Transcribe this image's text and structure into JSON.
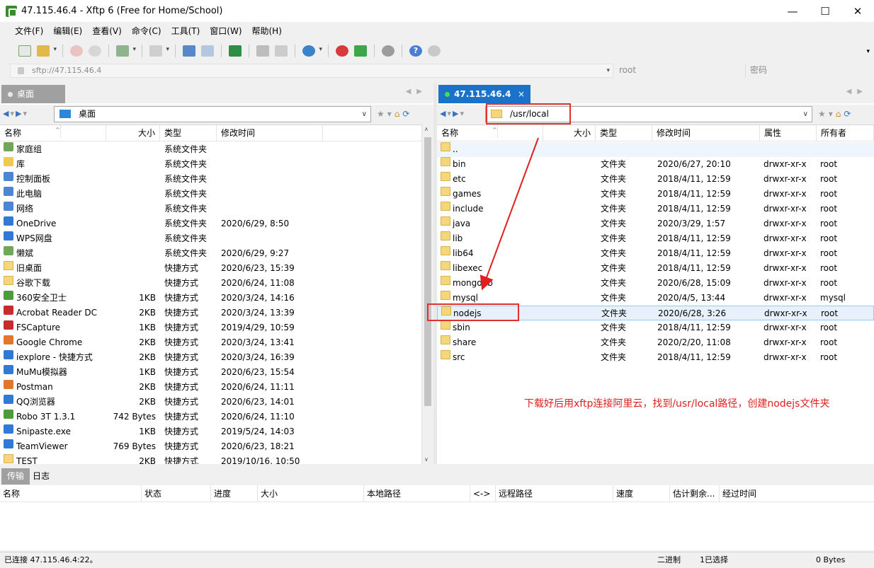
{
  "window": {
    "title": "47.115.46.4 - Xftp 6 (Free for Home/School)",
    "minimize": "—",
    "maximize": "☐",
    "close": "✕"
  },
  "menu": [
    "文件(F)",
    "编辑(E)",
    "查看(V)",
    "命令(C)",
    "工具(T)",
    "窗口(W)",
    "帮助(H)"
  ],
  "addressbar": {
    "url_placeholder": "sftp://47.115.46.4",
    "user_placeholder": "root",
    "password_placeholder": "密码"
  },
  "left": {
    "tab": "桌面",
    "path": "桌面",
    "columns": [
      "名称",
      "大小",
      "类型",
      "修改时间"
    ],
    "rows": [
      {
        "name": "家庭组",
        "size": "",
        "type": "系统文件夹",
        "date": "",
        "icon": "sys2"
      },
      {
        "name": "库",
        "size": "",
        "type": "系统文件夹",
        "date": "",
        "icon": "shortcut"
      },
      {
        "name": "控制面板",
        "size": "",
        "type": "系统文件夹",
        "date": "",
        "icon": "sys"
      },
      {
        "name": "此电脑",
        "size": "",
        "type": "系统文件夹",
        "date": "",
        "icon": "sys"
      },
      {
        "name": "网络",
        "size": "",
        "type": "系统文件夹",
        "date": "",
        "icon": "sys"
      },
      {
        "name": "OneDrive",
        "size": "",
        "type": "系统文件夹",
        "date": "2020/6/29, 8:50",
        "icon": "app-blue"
      },
      {
        "name": "WPS网盘",
        "size": "",
        "type": "系统文件夹",
        "date": "",
        "icon": "app-blue"
      },
      {
        "name": "懒斌",
        "size": "",
        "type": "系统文件夹",
        "date": "2020/6/29, 9:27",
        "icon": "sys2"
      },
      {
        "name": "旧桌面",
        "size": "",
        "type": "快捷方式",
        "date": "2020/6/23, 15:39",
        "icon": "folder"
      },
      {
        "name": "谷歌下载",
        "size": "",
        "type": "快捷方式",
        "date": "2020/6/24, 11:08",
        "icon": "folder"
      },
      {
        "name": "360安全卫士",
        "size": "1KB",
        "type": "快捷方式",
        "date": "2020/3/24, 14:16",
        "icon": "app-green"
      },
      {
        "name": "Acrobat Reader DC",
        "size": "2KB",
        "type": "快捷方式",
        "date": "2020/3/24, 13:39",
        "icon": "app-red"
      },
      {
        "name": "FSCapture",
        "size": "1KB",
        "type": "快捷方式",
        "date": "2019/4/29, 10:59",
        "icon": "app-red"
      },
      {
        "name": "Google Chrome",
        "size": "2KB",
        "type": "快捷方式",
        "date": "2020/3/24, 13:41",
        "icon": "app-orange"
      },
      {
        "name": "iexplore - 快捷方式",
        "size": "2KB",
        "type": "快捷方式",
        "date": "2020/3/24, 16:39",
        "icon": "app-blue"
      },
      {
        "name": "MuMu模拟器",
        "size": "1KB",
        "type": "快捷方式",
        "date": "2020/6/23, 15:54",
        "icon": "app-blue"
      },
      {
        "name": "Postman",
        "size": "2KB",
        "type": "快捷方式",
        "date": "2020/6/24, 11:11",
        "icon": "app-orange"
      },
      {
        "name": "QQ浏览器",
        "size": "2KB",
        "type": "快捷方式",
        "date": "2020/6/23, 14:01",
        "icon": "app-blue"
      },
      {
        "name": "Robo 3T 1.3.1",
        "size": "742 Bytes",
        "type": "快捷方式",
        "date": "2020/6/24, 11:10",
        "icon": "app-green"
      },
      {
        "name": "Snipaste.exe",
        "size": "1KB",
        "type": "快捷方式",
        "date": "2019/5/24, 14:03",
        "icon": "app-blue"
      },
      {
        "name": "TeamViewer",
        "size": "769 Bytes",
        "type": "快捷方式",
        "date": "2020/6/23, 18:21",
        "icon": "app-blue"
      },
      {
        "name": "TEST",
        "size": "2KB",
        "type": "快捷方式",
        "date": "2019/10/16, 10:50",
        "icon": "folder"
      }
    ]
  },
  "right": {
    "tab": "47.115.46.4",
    "tab_close": "×",
    "path": "/usr/local",
    "columns": [
      "名称",
      "大小",
      "类型",
      "修改时间",
      "属性",
      "所有者"
    ],
    "rows": [
      {
        "name": "..",
        "type": "",
        "date": "",
        "attr": "",
        "owner": ""
      },
      {
        "name": "bin",
        "type": "文件夹",
        "date": "2020/6/27, 20:10",
        "attr": "drwxr-xr-x",
        "owner": "root"
      },
      {
        "name": "etc",
        "type": "文件夹",
        "date": "2018/4/11, 12:59",
        "attr": "drwxr-xr-x",
        "owner": "root"
      },
      {
        "name": "games",
        "type": "文件夹",
        "date": "2018/4/11, 12:59",
        "attr": "drwxr-xr-x",
        "owner": "root"
      },
      {
        "name": "include",
        "type": "文件夹",
        "date": "2018/4/11, 12:59",
        "attr": "drwxr-xr-x",
        "owner": "root"
      },
      {
        "name": "java",
        "type": "文件夹",
        "date": "2020/3/29, 1:57",
        "attr": "drwxr-xr-x",
        "owner": "root"
      },
      {
        "name": "lib",
        "type": "文件夹",
        "date": "2018/4/11, 12:59",
        "attr": "drwxr-xr-x",
        "owner": "root"
      },
      {
        "name": "lib64",
        "type": "文件夹",
        "date": "2018/4/11, 12:59",
        "attr": "drwxr-xr-x",
        "owner": "root"
      },
      {
        "name": "libexec",
        "type": "文件夹",
        "date": "2018/4/11, 12:59",
        "attr": "drwxr-xr-x",
        "owner": "root"
      },
      {
        "name": "mongodb",
        "type": "文件夹",
        "date": "2020/6/28, 15:09",
        "attr": "drwxr-xr-x",
        "owner": "root"
      },
      {
        "name": "mysql",
        "type": "文件夹",
        "date": "2020/4/5, 13:44",
        "attr": "drwxr-xr-x",
        "owner": "mysql"
      },
      {
        "name": "nodejs",
        "type": "文件夹",
        "date": "2020/6/28, 3:26",
        "attr": "drwxr-xr-x",
        "owner": "root"
      },
      {
        "name": "sbin",
        "type": "文件夹",
        "date": "2018/4/11, 12:59",
        "attr": "drwxr-xr-x",
        "owner": "root"
      },
      {
        "name": "share",
        "type": "文件夹",
        "date": "2020/2/20, 11:08",
        "attr": "drwxr-xr-x",
        "owner": "root"
      },
      {
        "name": "src",
        "type": "文件夹",
        "date": "2018/4/11, 12:59",
        "attr": "drwxr-xr-x",
        "owner": "root"
      }
    ]
  },
  "annotation": {
    "text": "下载好后用xftp连接阿里云，找到/usr/local路径，创建nodejs文件夹",
    "color": "#e02020"
  },
  "transfer": {
    "tabs": [
      "传输",
      "日志"
    ],
    "columns": [
      "名称",
      "状态",
      "进度",
      "大小",
      "本地路径",
      "<->",
      "远程路径",
      "速度",
      "估计剩余...",
      "经过时间"
    ]
  },
  "status": {
    "connection": "已连接 47.115.46.4:22。",
    "mode": "二进制",
    "selected": "1已选择",
    "bytes": "0 Bytes"
  }
}
